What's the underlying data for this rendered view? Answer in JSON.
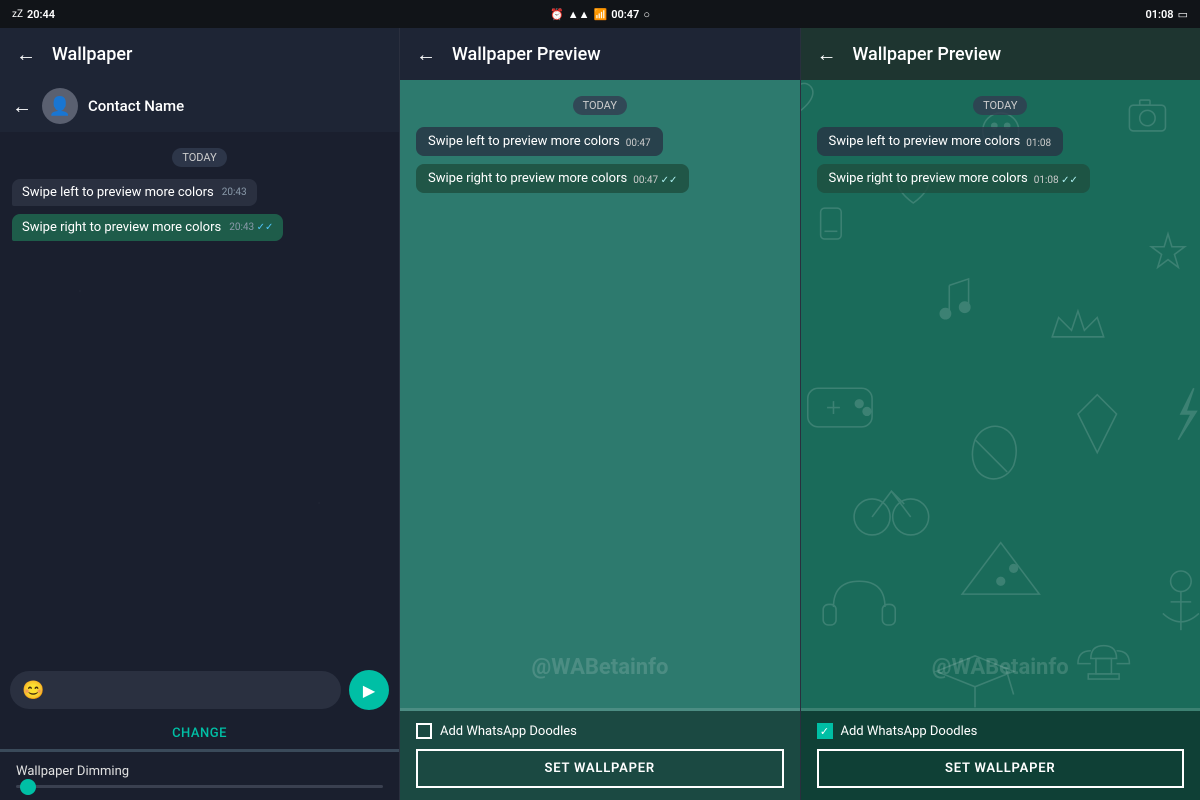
{
  "statusBar": {
    "left": {
      "time": "20:44",
      "icons": "zZ"
    },
    "center": {
      "time": "00:47"
    },
    "right": {
      "time": "01:08"
    }
  },
  "panel1": {
    "topBar": {
      "backLabel": "←",
      "title": "Wallpaper"
    },
    "chatHeader": {
      "contactName": "Contact Name",
      "backLabel": "←"
    },
    "dateBadge": "TODAY",
    "messages": [
      {
        "type": "received",
        "text": "Swipe left to preview more colors",
        "time": "20:43"
      },
      {
        "type": "sent",
        "text": "Swipe right to preview more colors",
        "time": "20:43",
        "ticks": "✓✓"
      }
    ],
    "changeLabel": "CHANGE",
    "dimmingLabel": "Wallpaper Dimming"
  },
  "panel2": {
    "topBar": {
      "backLabel": "←",
      "title": "Wallpaper Preview"
    },
    "dateBadge": "TODAY",
    "messages": [
      {
        "type": "received",
        "text": "Swipe left to preview more colors",
        "time": "00:47"
      },
      {
        "type": "sent",
        "text": "Swipe right to preview more colors",
        "time": "00:47",
        "ticks": "✓✓"
      }
    ],
    "addDoodles": "Add WhatsApp Doodles",
    "doodlesChecked": false,
    "setWallpaperLabel": "SET WALLPAPER"
  },
  "panel3": {
    "topBar": {
      "backLabel": "←",
      "title": "Wallpaper Preview"
    },
    "dateBadge": "TODAY",
    "messages": [
      {
        "type": "received",
        "text": "Swipe left to preview more colors",
        "time": "01:08"
      },
      {
        "type": "sent",
        "text": "Swipe right to preview more colors",
        "time": "01:08",
        "ticks": "✓✓"
      }
    ],
    "addDoodles": "Add WhatsApp Doodles",
    "doodlesChecked": true,
    "setWallpaperLabel": "SET WALLPAPER"
  },
  "watermark": "@WABetainfo"
}
